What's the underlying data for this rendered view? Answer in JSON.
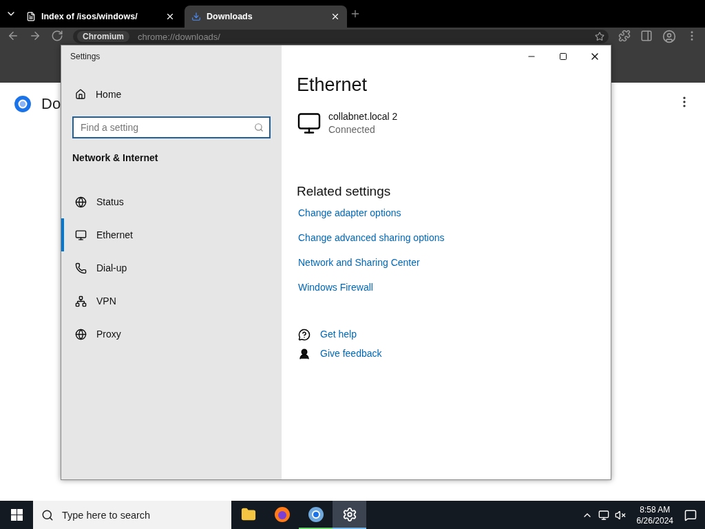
{
  "browser": {
    "tabs": [
      {
        "title": "Index of /isos/windows/",
        "kind": "page",
        "selected": false
      },
      {
        "title": "Downloads",
        "kind": "download",
        "selected": true
      }
    ],
    "address": {
      "chip": "Chromium",
      "url": "chrome://downloads/"
    },
    "page_title": "Do"
  },
  "settings": {
    "title": "Settings",
    "home": "Home",
    "search": {
      "placeholder": "Find a setting"
    },
    "section": "Network & Internet",
    "nav": [
      {
        "label": "Status",
        "kind": "status",
        "selected": false
      },
      {
        "label": "Ethernet",
        "kind": "ethernet",
        "selected": true
      },
      {
        "label": "Dial-up",
        "kind": "dialup",
        "selected": false
      },
      {
        "label": "VPN",
        "kind": "vpn",
        "selected": false
      },
      {
        "label": "Proxy",
        "kind": "proxy",
        "selected": false
      }
    ],
    "heading": "Ethernet",
    "connection": {
      "name": "collabnet.local 2",
      "status": "Connected"
    },
    "related": {
      "title": "Related settings",
      "links": [
        "Change adapter options",
        "Change advanced sharing options",
        "Network and Sharing Center",
        "Windows Firewall"
      ]
    },
    "help": [
      {
        "label": "Get help",
        "kind": "help"
      },
      {
        "label": "Give feedback",
        "kind": "feedback"
      }
    ]
  },
  "taskbar": {
    "search": {
      "placeholder": "Type here to search"
    },
    "apps": [
      {
        "kind": "folder",
        "running": false,
        "selected": false
      },
      {
        "kind": "firefox",
        "running": false,
        "selected": false
      },
      {
        "kind": "chromium",
        "running": true,
        "selected": false
      },
      {
        "kind": "settings",
        "running": true,
        "selected": true
      }
    ],
    "time": "8:58 AM",
    "date": "6/26/2024"
  }
}
